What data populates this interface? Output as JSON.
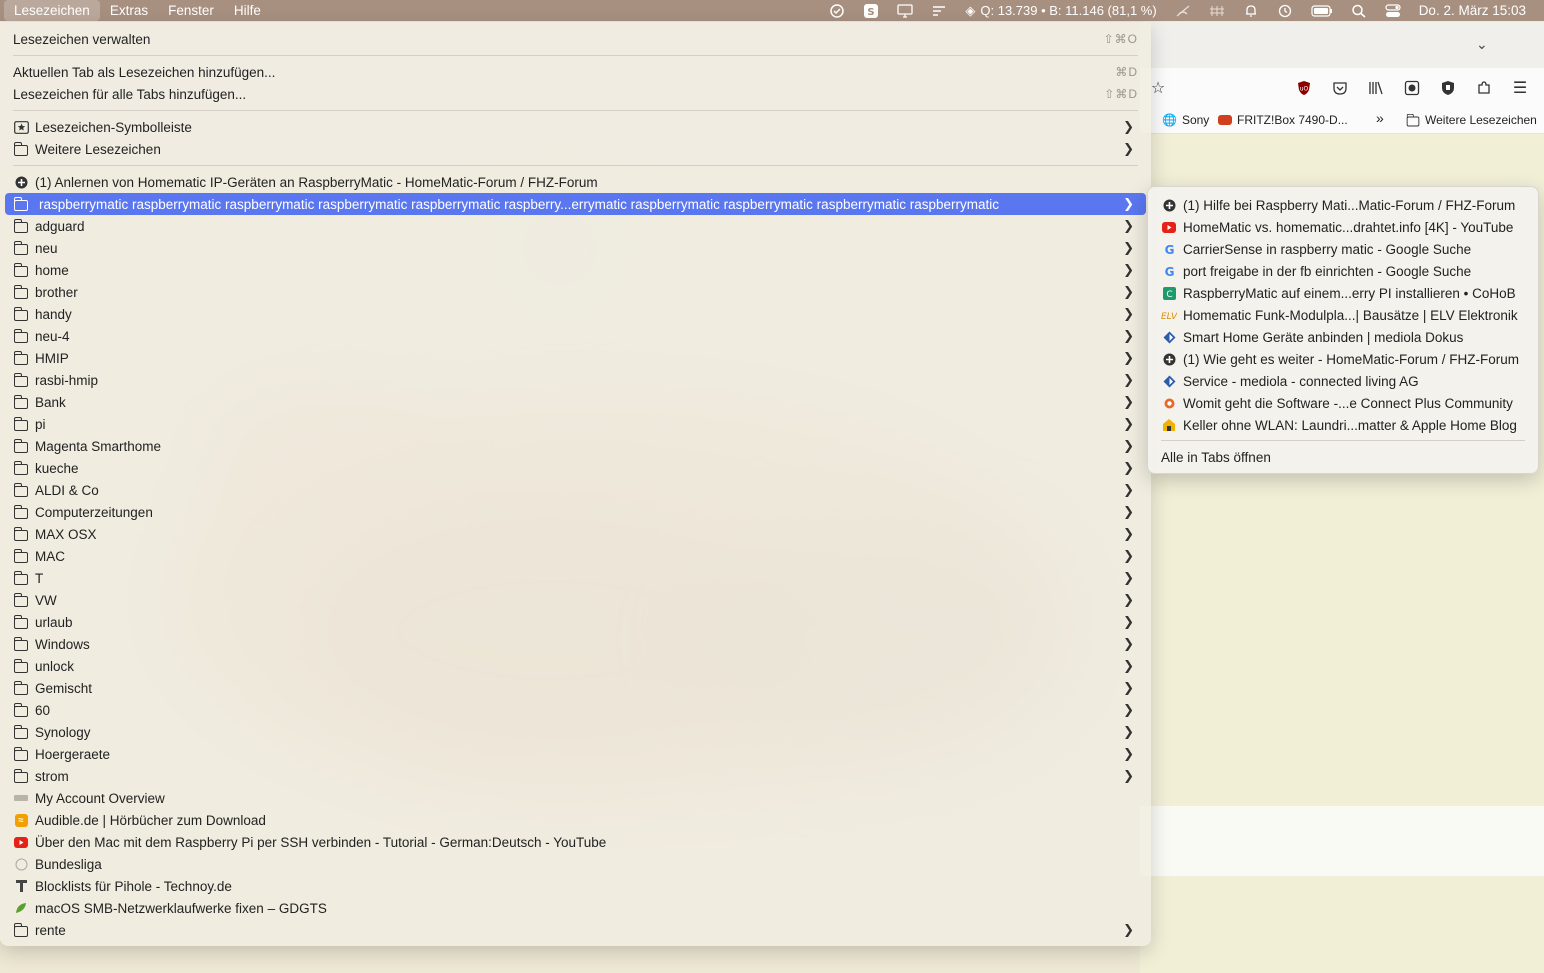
{
  "menubar": {
    "items": [
      "Lesezeichen",
      "Extras",
      "Fenster",
      "Hilfe"
    ],
    "status_text": "Q: 13.739 • B: 11.146 (81,1 %)",
    "datetime": "Do. 2. März  15:03"
  },
  "browser": {
    "bookmarks_bar": [
      "Sony",
      "FRITZ!Box 7490-D...",
      "Weitere Lesezeichen"
    ]
  },
  "menu": {
    "manage": {
      "label": "Lesezeichen verwalten",
      "shortcut": "⇧⌘O"
    },
    "add_current": {
      "label": "Aktuellen Tab als Lesezeichen hinzufügen...",
      "shortcut": "⌘D"
    },
    "add_all": {
      "label": "Lesezeichen für alle Tabs hinzufügen...",
      "shortcut": "⇧⌘D"
    },
    "toolbar_folder": "Lesezeichen-Symbolleiste",
    "other_folder": "Weitere Lesezeichen",
    "pinned_item": "(1) Anlernen von Homematic IP-Geräten an RaspberryMatic - HomeMatic-Forum / FHZ-Forum",
    "highlighted_folder": "raspberrymatic raspberrymatic raspberrymatic raspberrymatic raspberrymatic raspberry...errymatic raspberrymatic raspberrymatic raspberrymatic raspberrymatic",
    "folders": [
      "adguard",
      "neu",
      "home",
      "brother",
      "handy",
      "neu-4",
      "HMIP",
      "rasbi-hmip",
      "Bank",
      "pi",
      "Magenta Smarthome",
      "kueche",
      "ALDI & Co",
      "Computerzeitungen",
      "MAX OSX",
      "MAC",
      "T",
      "VW",
      "urlaub",
      "Windows",
      "unlock",
      "Gemischt",
      "60",
      "Synology",
      "Hoergeraete",
      "strom"
    ],
    "bookmarks": [
      {
        "label": "My Account Overview",
        "icon": "account-favicon"
      },
      {
        "label": "Audible.de | Hörbücher zum Download",
        "icon": "audible-favicon"
      },
      {
        "label": "Über den Mac mit dem Raspberry Pi per SSH verbinden - Tutorial - German:Deutsch - YouTube",
        "icon": "youtube-favicon"
      },
      {
        "label": "Bundesliga",
        "icon": "blank-favicon"
      },
      {
        "label": "Blocklists für Pihole - Technoy.de",
        "icon": "technoy-favicon"
      },
      {
        "label": "macOS SMB-Netzwerklaufwerke fixen – GDGTS",
        "icon": "gdgts-favicon"
      }
    ],
    "last_folder": "rente"
  },
  "submenu": {
    "items": [
      {
        "label": "(1) Hilfe bei Raspberry Mati...Matic-Forum / FHZ-Forum",
        "icon": "homematic-forum-favicon"
      },
      {
        "label": "HomeMatic vs. homematic...drahtet.info [4K] - YouTube",
        "icon": "youtube-favicon"
      },
      {
        "label": "CarrierSense in raspberry matic - Google Suche",
        "icon": "google-favicon"
      },
      {
        "label": "port freigabe in der fb einrichten - Google Suche",
        "icon": "google-favicon"
      },
      {
        "label": "RaspberryMatic auf einem...erry PI installieren • CoHoB",
        "icon": "cohob-favicon"
      },
      {
        "label": "Homematic Funk-Modulpla...| Bausätze | ELV Elektronik",
        "icon": "elv-favicon"
      },
      {
        "label": "Smart Home Geräte anbinden | mediola Dokus",
        "icon": "mediola-favicon"
      },
      {
        "label": "(1) Wie geht es weiter - HomeMatic-Forum / FHZ-Forum",
        "icon": "homematic-forum-favicon"
      },
      {
        "label": "Service - mediola - connected living AG",
        "icon": "mediola-favicon"
      },
      {
        "label": "Womit geht die Software -...e Connect Plus Community",
        "icon": "community-favicon"
      },
      {
        "label": "Keller ohne WLAN: Laundri...matter & Apple Home Blog",
        "icon": "apple-home-blog-favicon"
      }
    ],
    "open_all": "Alle in Tabs öffnen"
  }
}
